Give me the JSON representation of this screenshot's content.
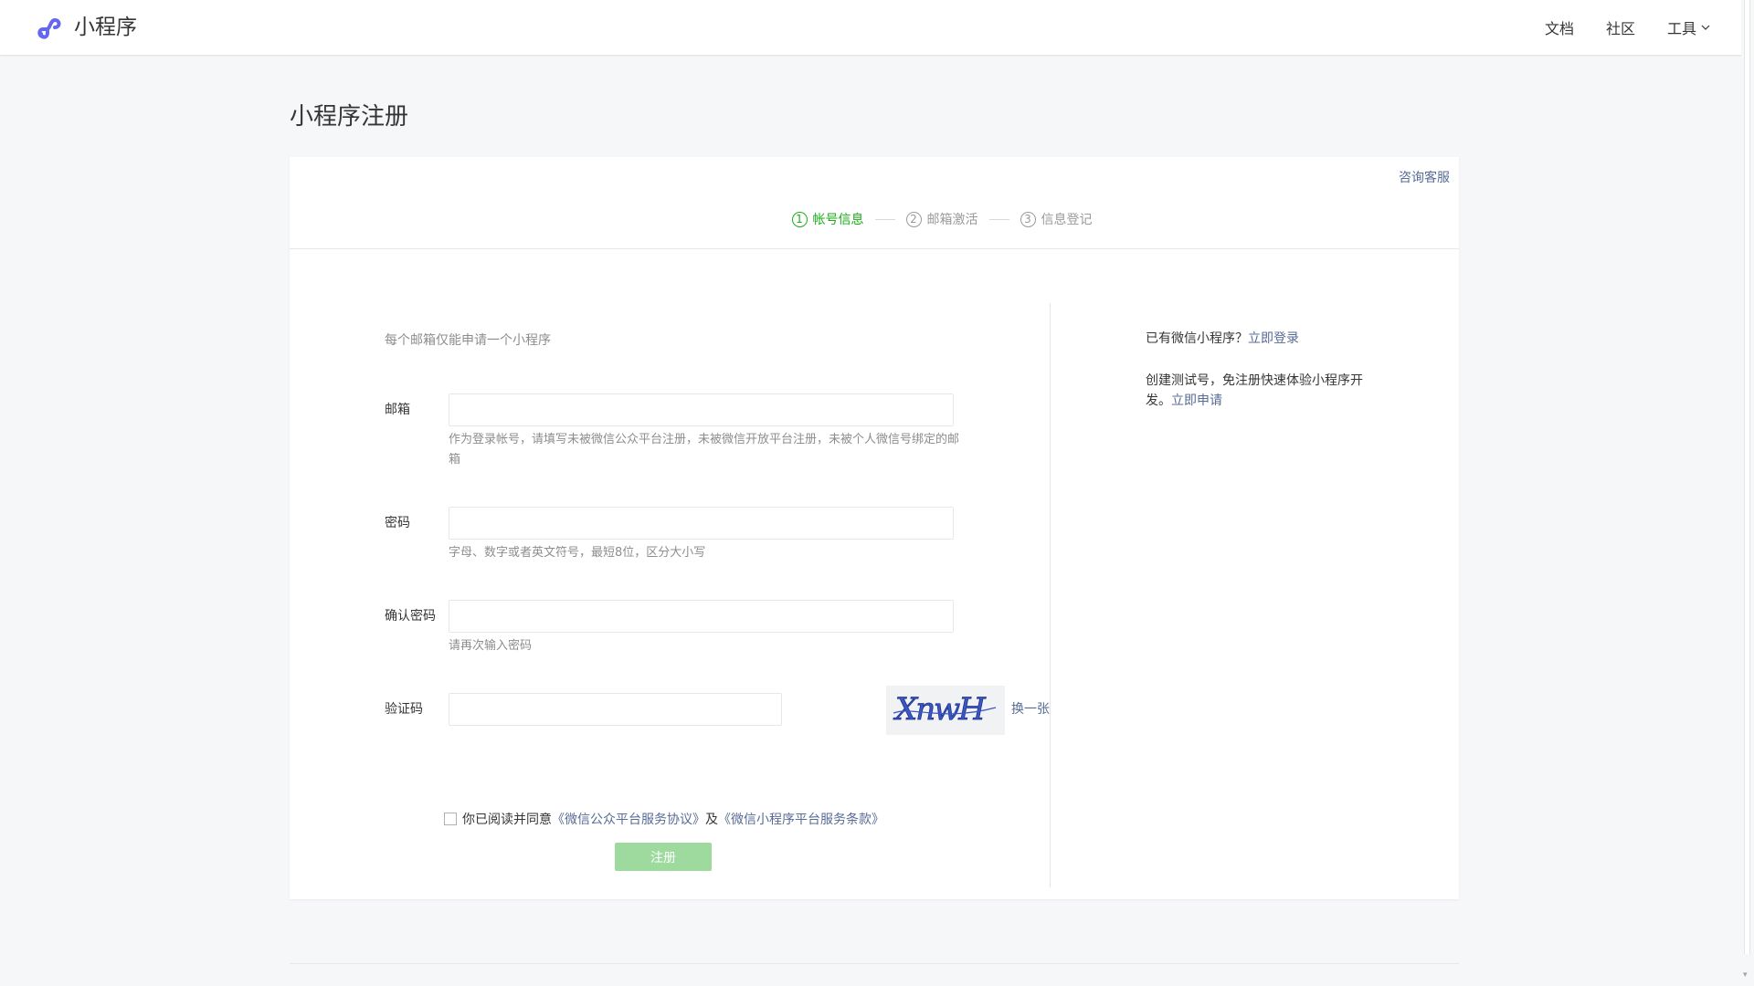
{
  "header": {
    "brand": "小程序",
    "nav": {
      "docs": "文档",
      "community": "社区",
      "tools": "工具"
    }
  },
  "page": {
    "title": "小程序注册"
  },
  "card": {
    "help_link": "咨询客服",
    "steps": [
      {
        "num": "1",
        "label": "帐号信息",
        "active": true
      },
      {
        "num": "2",
        "label": "邮箱激活",
        "active": false
      },
      {
        "num": "3",
        "label": "信息登记",
        "active": false
      }
    ]
  },
  "form": {
    "tips": "每个邮箱仅能申请一个小程序",
    "email": {
      "label": "邮箱",
      "value": "",
      "hint": "作为登录帐号，请填写未被微信公众平台注册，未被微信开放平台注册，未被个人微信号绑定的邮箱"
    },
    "password": {
      "label": "密码",
      "value": "",
      "hint": "字母、数字或者英文符号，最短8位，区分大小写"
    },
    "confirm_password": {
      "label": "确认密码",
      "value": "",
      "hint": "请再次输入密码"
    },
    "captcha": {
      "label": "验证码",
      "value": "",
      "image_text": "XnwH",
      "refresh": "换一张"
    },
    "agreement": {
      "prefix": "你已阅读并同意",
      "link1": "《微信公众平台服务协议》",
      "middle": "及",
      "link2": "《微信小程序平台服务条款》",
      "checked": false
    },
    "submit": "注册"
  },
  "side": {
    "line1_text": "已有微信小程序？",
    "line1_link": "立即登录",
    "line2_text": "创建测试号，免注册快速体验小程序开发。",
    "line2_link": "立即申请"
  },
  "colors": {
    "accent": "#1aad19",
    "link": "#576b95",
    "button_disabled": "#9ed99d"
  }
}
